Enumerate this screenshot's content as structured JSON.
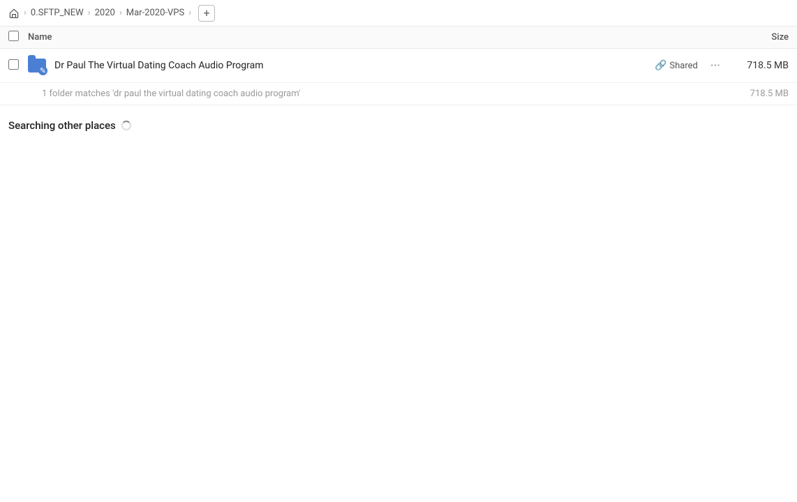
{
  "breadcrumb": {
    "home_icon": "🏠",
    "items": [
      {
        "label": "0.SFTP_NEW"
      },
      {
        "label": "2020"
      },
      {
        "label": "Mar-2020-VPS"
      }
    ],
    "add_label": "+"
  },
  "columns": {
    "name_label": "Name",
    "size_label": "Size"
  },
  "results": [
    {
      "name": "Dr Paul The Virtual Dating Coach Audio Program",
      "shared_label": "Shared",
      "more_label": "···",
      "size": "718.5 MB"
    }
  ],
  "match_info": "1 folder matches 'dr paul the virtual dating coach audio program'",
  "match_size": "718.5 MB",
  "searching_label": "Searching other places"
}
